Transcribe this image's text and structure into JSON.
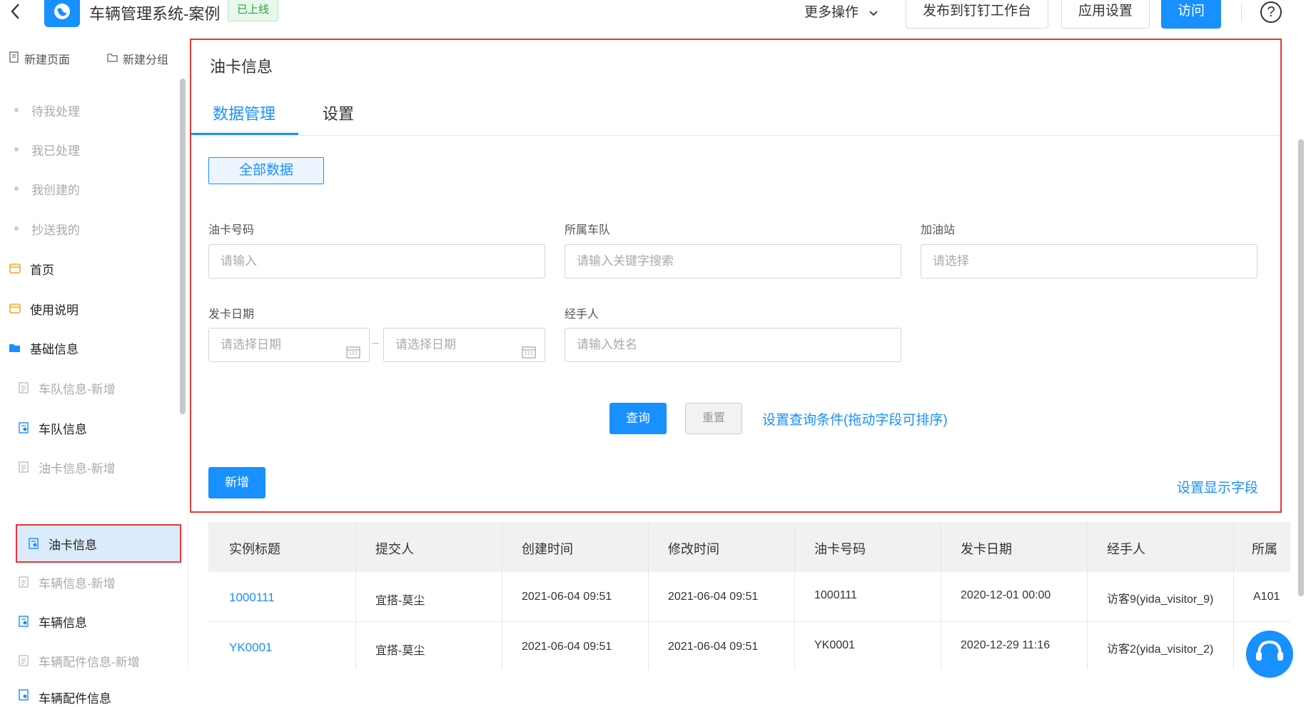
{
  "header": {
    "app_title": "车辆管理系统-案例",
    "status": "已上线",
    "more_ops": "更多操作",
    "publish": "发布到钉钉工作台",
    "app_settings": "应用设置",
    "visit": "访问",
    "help": "?"
  },
  "sidebar": {
    "new_page": "新建页面",
    "new_group": "新建分组",
    "items": [
      {
        "label": "待我处理"
      },
      {
        "label": "我已处理"
      },
      {
        "label": "我创建的"
      },
      {
        "label": "抄送我的"
      },
      {
        "label": "首页"
      },
      {
        "label": "使用说明"
      },
      {
        "label": "基础信息"
      },
      {
        "label": "车队信息-新增"
      },
      {
        "label": "车队信息"
      },
      {
        "label": "油卡信息-新增"
      },
      {
        "label": "油卡信息"
      },
      {
        "label": "车辆信息-新增"
      },
      {
        "label": "车辆信息"
      },
      {
        "label": "车辆配件信息-新增"
      },
      {
        "label": "车辆配件信息"
      }
    ]
  },
  "main": {
    "title": "油卡信息",
    "tabs": [
      {
        "label": "数据管理"
      },
      {
        "label": "设置"
      }
    ],
    "view": "全部数据",
    "filters": {
      "card_no": {
        "label": "油卡号码",
        "placeholder": "请输入"
      },
      "fleet": {
        "label": "所属车队",
        "placeholder": "请输入关键字搜索"
      },
      "station": {
        "label": "加油站",
        "placeholder": "请选择"
      },
      "issue_date": {
        "label": "发卡日期",
        "start": "请选择日期",
        "end": "请选择日期"
      },
      "handler": {
        "label": "经手人",
        "placeholder": "请输入姓名"
      }
    },
    "query": "查询",
    "reset": "重置",
    "set_query": "设置查询条件(拖动字段可排序)",
    "add": "新增",
    "set_display": "设置显示字段"
  },
  "table": {
    "headers": [
      "实例标题",
      "提交人",
      "创建时间",
      "修改时间",
      "油卡号码",
      "发卡日期",
      "经手人",
      "所属"
    ],
    "rows": [
      [
        "1000111",
        "宜搭-莫尘",
        "2021-06-04 09:51",
        "2021-06-04 09:51",
        "1000111",
        "2020-12-01 00:00",
        "访客9(yida_visitor_9)",
        "A101"
      ],
      [
        "YK0001",
        "宜搭-莫尘",
        "2021-06-04 09:51",
        "2021-06-04 09:51",
        "YK0001",
        "2020-12-29 11:16",
        "访客2(yida_visitor_2)",
        ""
      ]
    ]
  },
  "colors": {
    "accent": "#1890ff",
    "highlight": "#e53935"
  }
}
